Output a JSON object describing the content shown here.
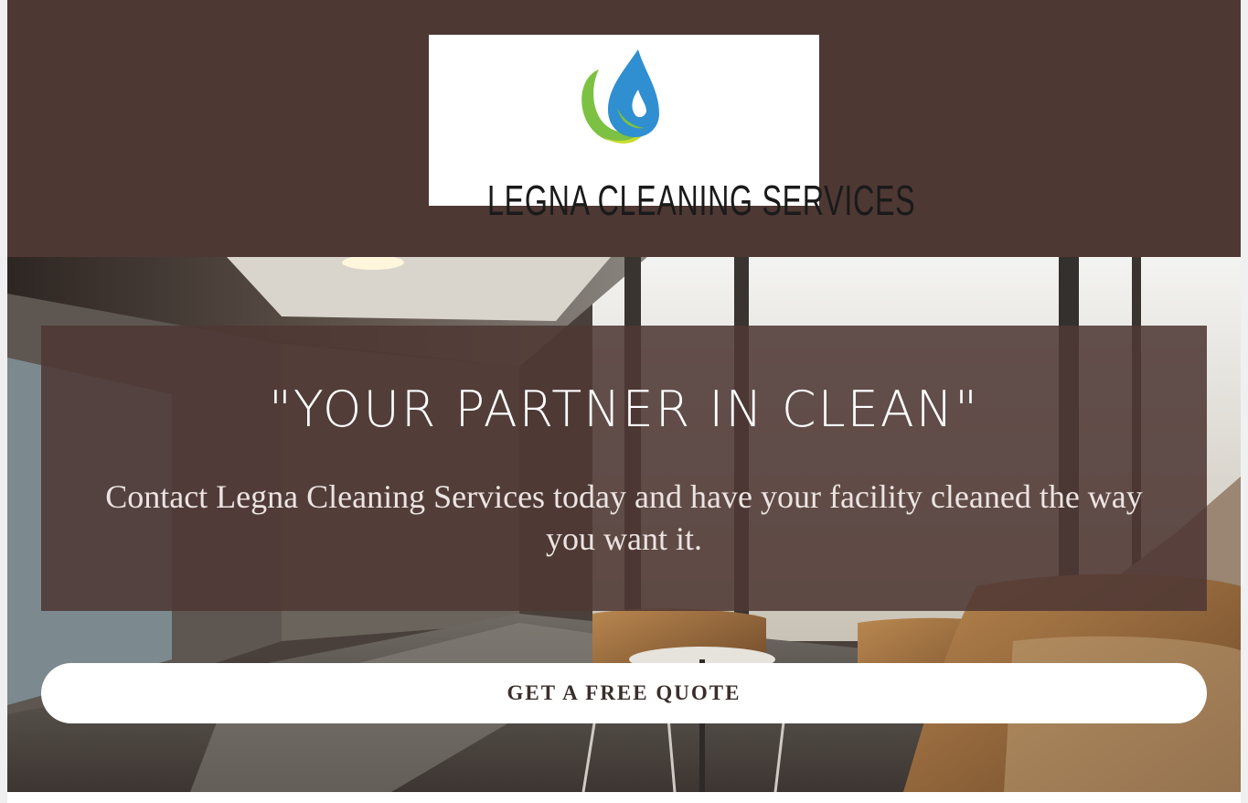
{
  "header": {
    "logo": {
      "text": "LEGNA CLEANING SERVICES",
      "icon": "water-drop-icon",
      "colors": {
        "drop": "#2f8fd0",
        "leaf": "#7cc142"
      }
    },
    "background_color": "#4e3834"
  },
  "hero": {
    "background_image": "office-corridor-with-lounge-chairs",
    "title": "\"YOUR PARTNER IN CLEAN\"",
    "subtitle": "Contact Legna Cleaning Services today and have your facility cleaned the way you want it.",
    "overlay_color": "#4e3834",
    "cta": {
      "label": "GET A FREE QUOTE"
    }
  }
}
